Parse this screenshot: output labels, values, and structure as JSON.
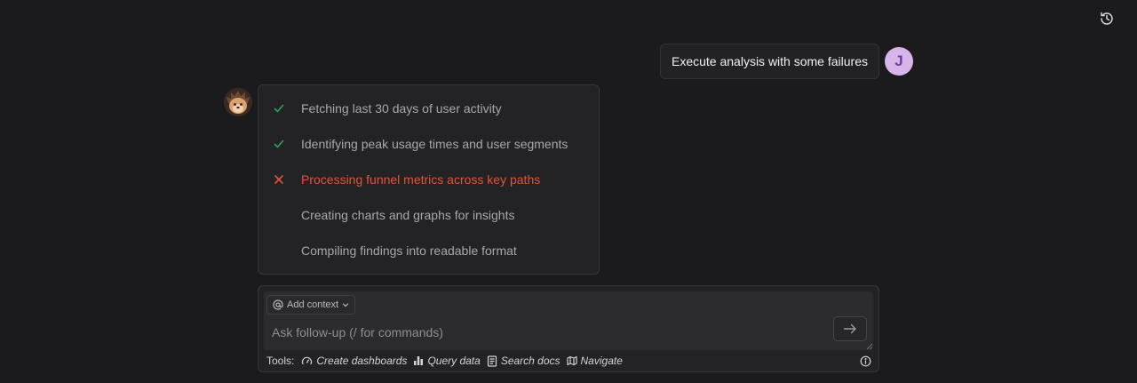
{
  "header": {
    "history_icon": "history-icon"
  },
  "conversation": {
    "user_message": "Execute analysis with some failures",
    "user_initial": "J",
    "assistant_avatar_icon": "hedgehog-avatar",
    "steps": [
      {
        "label": "Fetching last 30 days of user activity",
        "status": "done"
      },
      {
        "label": "Identifying peak usage times and user segments",
        "status": "done"
      },
      {
        "label": "Processing funnel metrics across key paths",
        "status": "failed"
      },
      {
        "label": "Creating charts and graphs for insights",
        "status": "pending"
      },
      {
        "label": "Compiling findings into readable format",
        "status": "pending"
      }
    ]
  },
  "composer": {
    "context_button": "Add context",
    "placeholder": "Ask follow-up (/ for commands)",
    "value": "",
    "tools_label": "Tools:",
    "tools": [
      {
        "label": "Create dashboards",
        "icon": "dashboard-icon"
      },
      {
        "label": "Query data",
        "icon": "bar-chart-icon"
      },
      {
        "label": "Search docs",
        "icon": "docs-icon"
      },
      {
        "label": "Navigate",
        "icon": "navigate-icon"
      }
    ]
  },
  "colors": {
    "background": "#1b1b1d",
    "success": "#2f9e5e",
    "error": "#e2533a",
    "user_avatar": "#d7b4ea"
  }
}
